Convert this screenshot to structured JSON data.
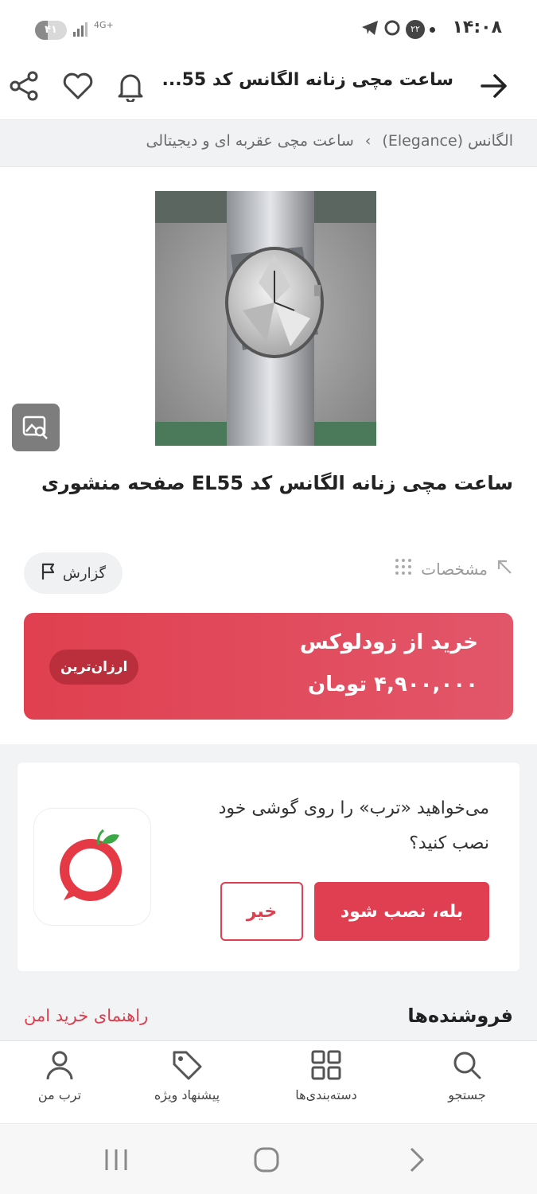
{
  "status_bar": {
    "time": "۱۴:۰۸",
    "notification_count": "۲۲",
    "battery": "۴۱",
    "battery_level": 0.41,
    "network": "4G+"
  },
  "header": {
    "title": "ساعت مچی زنانه الگانس کد 55..."
  },
  "breadcrumb": {
    "items": [
      "ساعت مچی عقربه ای و دیجیتالی",
      "›",
      "الگانس (Elegance)"
    ]
  },
  "product": {
    "title": "ساعت مچی زنانه الگانس کد EL55 صفحه منشوری",
    "specs_label": "مشخصات",
    "report_label": "گزارش"
  },
  "buy": {
    "store_label": "خرید از زودلوکس",
    "price": "۴,۹۰۰,۰۰۰ تومان",
    "badge": "ارزان‌ترین"
  },
  "install_prompt": {
    "text": "می‌خواهید «ترب» را روی گوشی خود نصب کنید؟",
    "yes_label": "بله، نصب شود",
    "no_label": "خیر"
  },
  "sellers": {
    "title": "فروشنده‌ها",
    "guide_link": "راهنمای خرید امن"
  },
  "bottom_nav": {
    "items": [
      {
        "label": "جستجو",
        "icon": "search-icon"
      },
      {
        "label": "دسته‌بندی‌ها",
        "icon": "grid-icon"
      },
      {
        "label": "پیشنهاد ویژه",
        "icon": "tag-icon"
      },
      {
        "label": "ترب من",
        "icon": "user-icon"
      }
    ]
  },
  "colors": {
    "accent": "#df3f50",
    "breadcrumb_bg": "#f1f2f3"
  }
}
